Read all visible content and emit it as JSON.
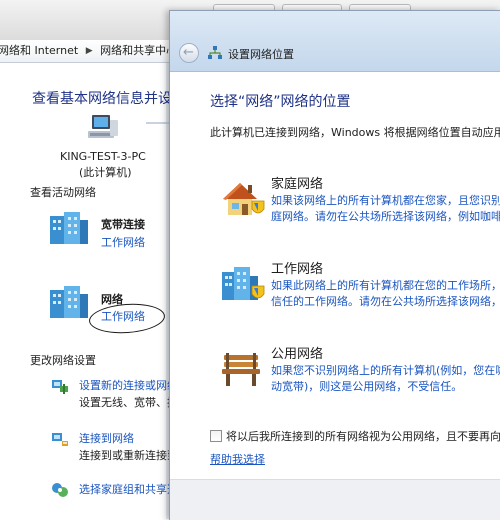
{
  "colors": {
    "heading": "#1e3287",
    "link": "#1a55c0",
    "header_bg": "#c4d7ec"
  },
  "background_window": {
    "breadcrumb": [
      "网络和 Internet",
      "网络和共享中心"
    ],
    "heading": "查看基本网络信息并设",
    "computer": {
      "icon": "computer-icon",
      "name": "KING-TEST-3-PC",
      "sub": "(此计算机)"
    },
    "active_networks_label": "查看活动网络",
    "networks": [
      {
        "icon": "network-building-icon",
        "name": "宽带连接",
        "type_link": "工作网络"
      },
      {
        "icon": "network-building-icon",
        "name": "网络",
        "type_link": "工作网络"
      }
    ],
    "change_settings_label": "更改网络设置",
    "tasks": [
      {
        "icon": "network-setup-icon",
        "link": "设置新的连接或网络",
        "desc": "设置无线、宽带、拨"
      },
      {
        "icon": "connect-network-icon",
        "link": "连接到网络",
        "desc": "连接到或重新连接到"
      },
      {
        "icon": "homegroup-icon",
        "link": "选择家庭组和共享选",
        "desc": ""
      }
    ]
  },
  "dialog": {
    "title": "设置网络位置",
    "title_icon": "network-location-icon",
    "back_icon": "back-arrow-icon",
    "heading": "选择“网络”网络的位置",
    "intro": "此计算机已连接到网络，Windows 将根据网络位置自动应用正",
    "options": [
      {
        "icon": "home-network-icon",
        "title": "家庭网络",
        "desc1": "如果该网络上的所有计算机都在您家，且您识别这",
        "desc2": "庭网络。请勿在公共场所选择该网络，例如咖啡厅"
      },
      {
        "icon": "work-network-icon",
        "title": "工作网络",
        "desc1": "如果此网络上的所有计算机都在您的工作场所，且",
        "desc2": "信任的工作网络。请勿在公共场所选择该网络，例"
      },
      {
        "icon": "public-network-icon",
        "title": "公用网络",
        "desc1": "如果您不识别网络上的所有计算机(例如，您在咖啡",
        "desc2": "动宽带)，则这是公用网络，不受信任。"
      }
    ],
    "checkbox_label": "将以后我所连接到的所有网络视为公用网络，且不要再向我",
    "checkbox_checked": false,
    "help_link": "帮助我选择"
  }
}
